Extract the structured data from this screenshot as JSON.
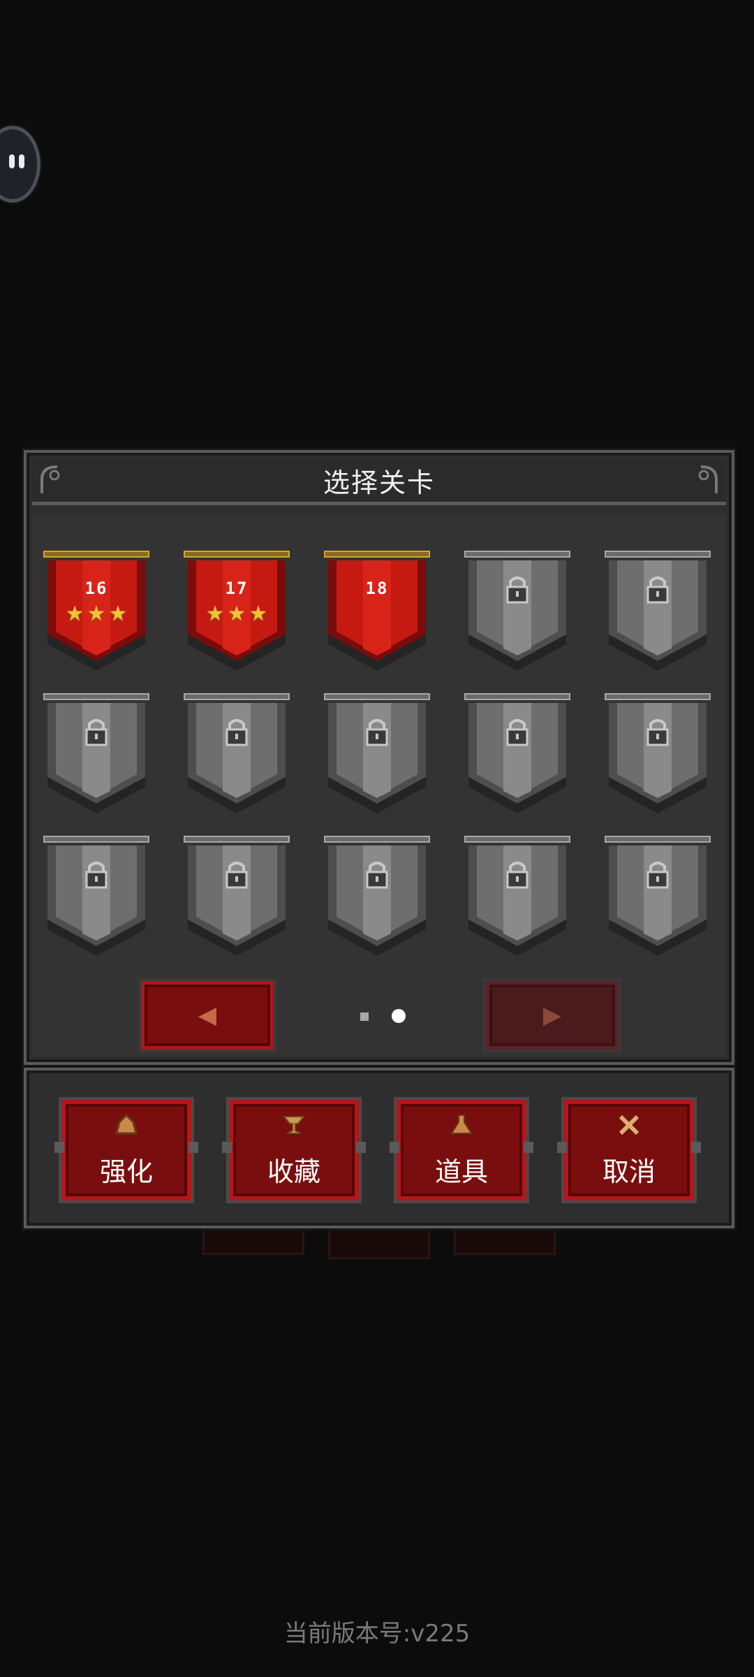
{
  "dialog": {
    "title": "选择关卡"
  },
  "levels": [
    {
      "number": "16",
      "state": "unlocked",
      "stars": 3
    },
    {
      "number": "17",
      "state": "unlocked",
      "stars": 3
    },
    {
      "number": "18",
      "state": "unlocked",
      "stars": 0
    },
    {
      "number": "",
      "state": "locked",
      "stars": 0
    },
    {
      "number": "",
      "state": "locked",
      "stars": 0
    },
    {
      "number": "",
      "state": "locked",
      "stars": 0
    },
    {
      "number": "",
      "state": "locked",
      "stars": 0
    },
    {
      "number": "",
      "state": "locked",
      "stars": 0
    },
    {
      "number": "",
      "state": "locked",
      "stars": 0
    },
    {
      "number": "",
      "state": "locked",
      "stars": 0
    },
    {
      "number": "",
      "state": "locked",
      "stars": 0
    },
    {
      "number": "",
      "state": "locked",
      "stars": 0
    },
    {
      "number": "",
      "state": "locked",
      "stars": 0
    },
    {
      "number": "",
      "state": "locked",
      "stars": 0
    },
    {
      "number": "",
      "state": "locked",
      "stars": 0
    }
  ],
  "pager": {
    "prev_icon": "arrow-left-icon",
    "next_icon": "arrow-right-icon",
    "page_count": 2,
    "current_page": 2
  },
  "actions": [
    {
      "label": "强化",
      "icon": "upgrade-icon"
    },
    {
      "label": "收藏",
      "icon": "trophy-icon"
    },
    {
      "label": "道具",
      "icon": "potion-icon"
    },
    {
      "label": "取消",
      "icon": "close-icon"
    }
  ],
  "footer": {
    "version_text": "当前版本号:v225"
  },
  "colors": {
    "banner_red": "#c41a12",
    "banner_gray": "#6e6e6e",
    "star": "#f2c33a",
    "button_red": "#7a0e0e"
  }
}
